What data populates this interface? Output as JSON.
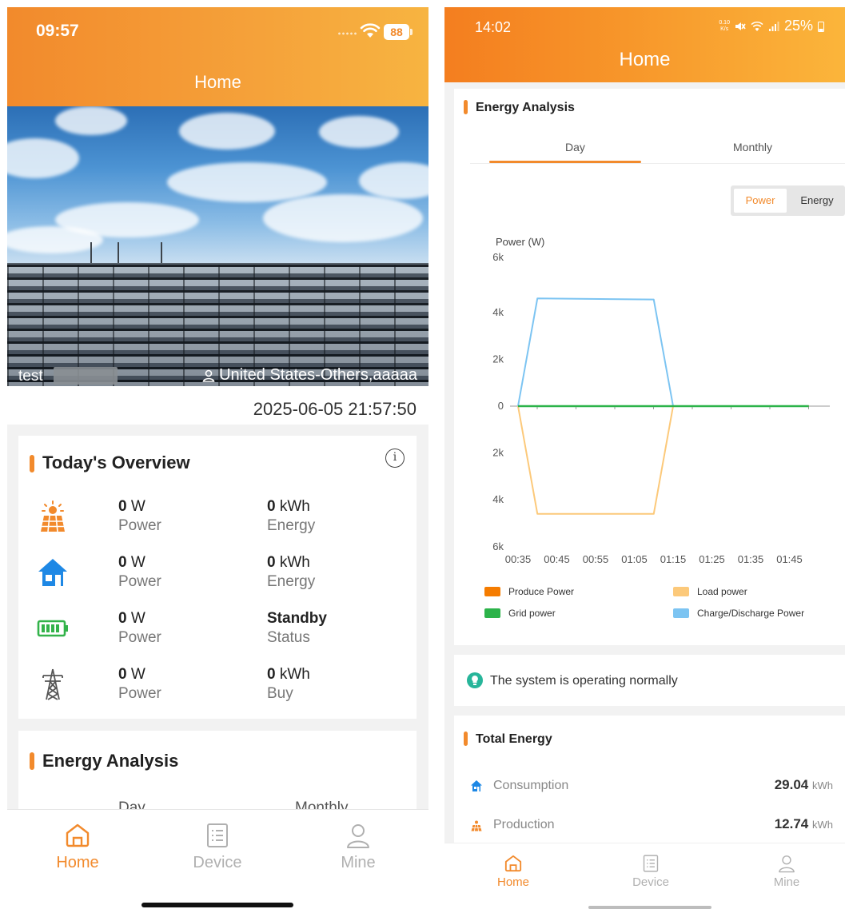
{
  "left": {
    "status": {
      "time": "09:57",
      "battery": "88"
    },
    "header": {
      "title": "Home"
    },
    "hero": {
      "name": "test",
      "location": "United States-Others,aaaaa"
    },
    "datetime": "2025-06-05 21:57:50",
    "overview": {
      "title": "Today's Overview",
      "info_icon": "info-icon",
      "rows": [
        {
          "icon": "solar-panel-icon",
          "v1": "0",
          "u1": "W",
          "l1": "Power",
          "v2": "0",
          "u2": "kWh",
          "l2": "Energy"
        },
        {
          "icon": "house-icon",
          "v1": "0",
          "u1": "W",
          "l1": "Power",
          "v2": "0",
          "u2": "kWh",
          "l2": "Energy"
        },
        {
          "icon": "battery-icon",
          "v1": "0",
          "u1": "W",
          "l1": "Power",
          "v2": "Standby",
          "u2": "",
          "l2": "Status"
        },
        {
          "icon": "grid-tower-icon",
          "v1": "0",
          "u1": "W",
          "l1": "Power",
          "v2": "0",
          "u2": "kWh",
          "l2": "Buy"
        }
      ]
    },
    "energy_analysis": {
      "title": "Energy Analysis",
      "tabs": [
        "Day",
        "Monthly"
      ]
    },
    "nav": [
      {
        "label": "Home",
        "icon": "home-icon",
        "active": true
      },
      {
        "label": "Device",
        "icon": "device-list-icon",
        "active": false
      },
      {
        "label": "Mine",
        "icon": "user-icon",
        "active": false
      }
    ]
  },
  "right": {
    "status": {
      "time": "14:02",
      "net_speed_value": "0.10",
      "net_speed_unit": "K/s",
      "battery": "25%"
    },
    "header": {
      "title": "Home"
    },
    "energy_analysis": {
      "title": "Energy Analysis",
      "tabs": [
        "Day",
        "Monthly"
      ],
      "active_tab": "Day",
      "toggle": [
        "Power",
        "Energy"
      ],
      "active_toggle": "Power"
    },
    "chart_data": {
      "type": "line",
      "ylabel": "Power (W)",
      "y_ticks": [
        "6k",
        "4k",
        "2k",
        "0",
        "2k",
        "4k",
        "6k"
      ],
      "ylim": [
        -6000,
        6000
      ],
      "x_ticks": [
        "00:35",
        "00:45",
        "00:55",
        "01:05",
        "01:15",
        "01:25",
        "01:35",
        "01:45"
      ],
      "x": [
        "00:35",
        "00:40",
        "01:10",
        "01:15",
        "01:50"
      ],
      "series": [
        {
          "name": "Produce Power",
          "color": "#f57c00",
          "values": [
            0,
            0,
            0,
            0,
            0
          ]
        },
        {
          "name": "Load power",
          "color": "#fcc97a",
          "values": [
            0,
            -4600,
            -4600,
            0,
            0
          ]
        },
        {
          "name": "Grid power",
          "color": "#2cb34a",
          "values": [
            0,
            0,
            0,
            0,
            0
          ]
        },
        {
          "name": "Charge/Discharge Power",
          "color": "#7cc4f2",
          "values": [
            0,
            4600,
            4550,
            0,
            0
          ]
        }
      ]
    },
    "system_status": "The system is operating normally",
    "total_energy": {
      "title": "Total Energy",
      "rows": [
        {
          "label": "Consumption",
          "icon": "house-icon",
          "value": "29.04",
          "unit": "kWh"
        },
        {
          "label": "Production",
          "icon": "solar-panel-icon",
          "value": "12.74",
          "unit": "kWh"
        }
      ]
    },
    "nav": [
      {
        "label": "Home",
        "icon": "home-icon",
        "active": true
      },
      {
        "label": "Device",
        "icon": "device-list-icon",
        "active": false
      },
      {
        "label": "Mine",
        "icon": "user-icon",
        "active": false
      }
    ]
  },
  "colors": {
    "accent": "#f28a2c",
    "inactive": "#b0b0b0",
    "house_blue": "#1e88e5",
    "battery_green": "#33b34a"
  }
}
